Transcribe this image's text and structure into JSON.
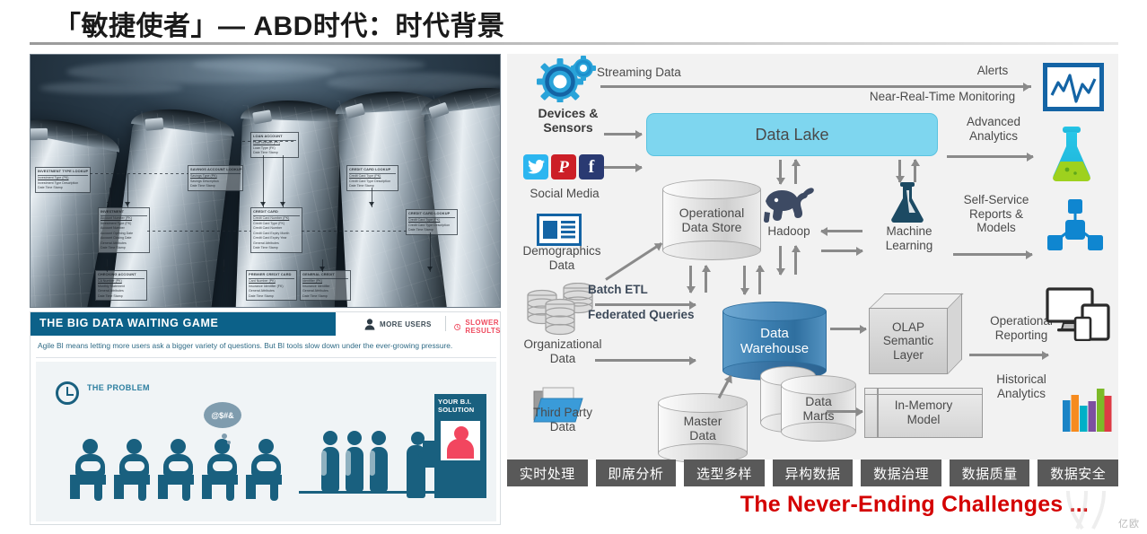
{
  "slide": {
    "title": "「敏捷使者」— ABD时代：时代背景"
  },
  "left_panel": {
    "photo": {
      "name": "data-silos-photo",
      "description": "Metallic grain silos under a dark stormy sky overlaid with translucent ER-diagram entity boxes",
      "er_boxes": [
        {
          "title": "INVESTMENT TYPE LOOKUP",
          "key": "Investment Type (PK)",
          "fields": [
            "Investment Type Description",
            "Date Time Stamp"
          ]
        },
        {
          "title": "INVESTMENT",
          "key": "Account Number (PK)",
          "fields": [
            "Investment Type (FK)",
            "Account Number",
            "Account Opening Date",
            "Account Closing Date",
            "General Attributes",
            "Date Time Stamp"
          ]
        },
        {
          "title": "CHECKING ACCOUNT",
          "key": "CA Number (PK)",
          "fields": [
            "Monthly Statement",
            "General Attributes",
            "Date Time Stamp"
          ]
        },
        {
          "title": "SAVINGS ACCOUNT LOOKUP",
          "key": "Savings Type (PK)",
          "fields": [
            "Savings Description",
            "Date Time Stamp"
          ]
        },
        {
          "title": "CREDIT CARD",
          "key": "Credit Card Number (PK)",
          "fields": [
            "Credit Card Type (FK)",
            "Credit Card Number",
            "Credit Card Expiry Month",
            "Credit Card Expiry Year",
            "General Attributes",
            "Date Time Stamp"
          ]
        },
        {
          "title": "PREMIER CREDIT CARD",
          "key": "Card Number (PK)",
          "fields": [
            "Insurance Identifier (FK)",
            "General Attributes",
            "Date Time Stamp"
          ]
        },
        {
          "title": "GENERAL CREDIT",
          "key": "Identifier (PK)",
          "fields": [
            "Insurance Identifier",
            "General Attributes",
            "Date Time Stamp"
          ]
        },
        {
          "title": "LOAN ACCOUNT",
          "key": "Loan Number (PK)",
          "fields": [
            "Loan Type (FK)",
            "Date Time Stamp"
          ]
        },
        {
          "title": "CREDIT CARD LOOKUP",
          "key": "Credit Card Type (PK)",
          "fields": [
            "Credit Card Type Description",
            "Date Time Stamp"
          ]
        }
      ]
    },
    "bi_card": {
      "header_title": "THE BIG DATA WAITING GAME",
      "stat_more_users": "MORE USERS",
      "stat_slower_results": "SLOWER RESULTS",
      "subtitle": "Agile BI means letting more users ask a bigger variety of questions. But BI tools slow down under the ever-growing pressure.",
      "infographic": {
        "problem_label": "THE\nPROBLEM",
        "thought_text": "@$#&",
        "kiosk_label": "YOUR B.I.\nSOLUTION",
        "seated_count": 5,
        "standing_count": 3
      }
    }
  },
  "diagram": {
    "sources": [
      {
        "id": "devices-sensors",
        "label": "Devices &\nSensors",
        "icon": "gears-icon"
      },
      {
        "id": "social-media",
        "label": "Social Media",
        "icon": "social-icons"
      },
      {
        "id": "demographics-data",
        "label": "Demographics\nData",
        "icon": "news-card-icon"
      },
      {
        "id": "organizational-data",
        "label": "Organizational\nData",
        "icon": "database-stack-icon"
      },
      {
        "id": "third-party-data",
        "label": "Third Party\nData",
        "icon": "folder-icon"
      }
    ],
    "stores": [
      {
        "id": "data-lake",
        "label": "Data Lake",
        "color": "#7ed6ef"
      },
      {
        "id": "operational-data-store",
        "label": "Operational\nData Store"
      },
      {
        "id": "hadoop",
        "label": "Hadoop",
        "icon": "hadoop-elephant-icon"
      },
      {
        "id": "machine-learning",
        "label": "Machine\nLearning",
        "icon": "flask-icon"
      },
      {
        "id": "data-warehouse",
        "label": "Data\nWarehouse",
        "color": "#3c7fb1"
      },
      {
        "id": "master-data",
        "label": "Master\nData"
      },
      {
        "id": "data-marts",
        "label": "Data\nMarts"
      },
      {
        "id": "olap-semantic-layer",
        "label": "OLAP\nSemantic\nLayer"
      },
      {
        "id": "in-memory-model",
        "label": "In-Memory\nModel"
      }
    ],
    "flow_labels": [
      {
        "id": "streaming-data",
        "label": "Streaming Data"
      },
      {
        "id": "batch-etl",
        "label": "Batch ETL"
      },
      {
        "id": "federated-queries",
        "label": "Federated Queries"
      },
      {
        "id": "alerts",
        "label": "Alerts"
      },
      {
        "id": "near-real-time-monitoring",
        "label": "Near-Real-Time Monitoring"
      },
      {
        "id": "advanced-analytics",
        "label": "Advanced\nAnalytics"
      },
      {
        "id": "self-service-reports",
        "label": "Self-Service\nReports &\nModels"
      },
      {
        "id": "operational-reporting",
        "label": "Operational\nReporting"
      },
      {
        "id": "historical-analytics",
        "label": "Historical\nAnalytics"
      }
    ],
    "outputs": [
      {
        "id": "monitoring-screen",
        "icon": "line-chart-monitor-icon"
      },
      {
        "id": "advanced-analytics-flask",
        "icon": "flask-gradient-icon"
      },
      {
        "id": "self-service-nodes",
        "icon": "node-network-icon"
      },
      {
        "id": "devices-screens",
        "icon": "desktop-tablet-phone-icon"
      },
      {
        "id": "bar-chart",
        "icon": "bar-chart-icon"
      }
    ]
  },
  "tags": [
    "实时处理",
    "即席分析",
    "选型多样",
    "异构数据",
    "数据治理",
    "数据质量",
    "数据安全"
  ],
  "footer": {
    "never_ending": "The Never-Ending Challenges ...",
    "watermark": "亿欧"
  },
  "colors": {
    "title": "#1a1a1a",
    "data_lake": "#7ed6ef",
    "data_warehouse": "#3c7fb1",
    "tag_bg": "#595959",
    "never_ending": "#d40000",
    "bi_blue": "#0c6189",
    "bi_red": "#ef4b5f",
    "arrow": "#8a8a8a"
  }
}
